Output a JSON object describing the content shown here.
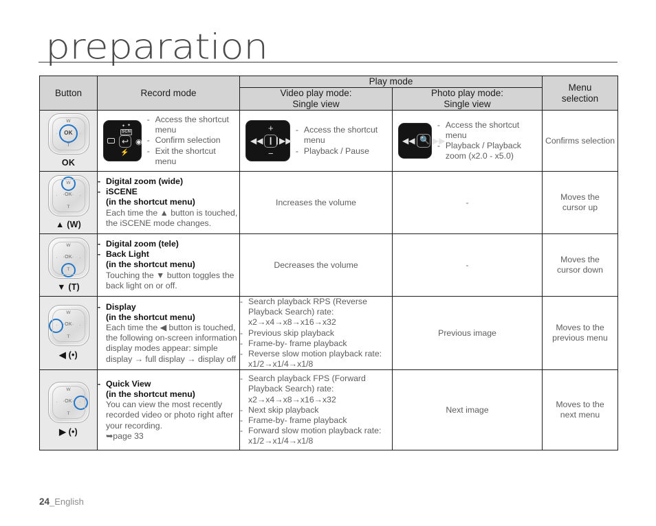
{
  "page": {
    "title": "preparation",
    "footer_page": "24",
    "footer_lang": "_English"
  },
  "accent_color": "#2176c9",
  "table": {
    "headers": {
      "button": "Button",
      "record_mode": "Record mode",
      "play_mode": "Play mode",
      "video_play_mode": "Video play mode:\nSingle view",
      "video_play_mode_l1": "Video play mode:",
      "video_play_mode_l2": "Single view",
      "photo_play_mode_l1": "Photo play mode:",
      "photo_play_mode_l2": "Single view",
      "menu_selection_l1": "Menu",
      "menu_selection_l2": "selection"
    },
    "rows": [
      {
        "button_label": "OK",
        "button_center_text": "OK",
        "pad_w": "W",
        "pad_t": "T",
        "record_items": [
          "Access the shortcut menu",
          "Confirm selection",
          "Exit the shortcut menu"
        ],
        "video_items": [
          "Access the shortcut menu",
          "Playback / Pause"
        ],
        "photo_items": [
          "Access the shortcut menu",
          "Playback / Playback zoom (x2.0 - x5.0)"
        ],
        "menu": "Confirms selection",
        "lcd_record_icons": [
          "scn-icon",
          "rectangle-icon",
          "return-arrow-icon",
          "play-circle-icon",
          "flash-icon"
        ],
        "lcd_video_icons": [
          "plus-icon",
          "prev-track-icon",
          "pause-icon",
          "next-track-icon",
          "minus-icon"
        ],
        "lcd_photo_icons": [
          "prev-track-icon",
          "zoom-in-icon",
          "next-track-icon"
        ]
      },
      {
        "button_label": "▲ (W)",
        "record_bold": [
          "Digital zoom (wide)",
          "iSCENE"
        ],
        "record_subbold": "(in the shortcut menu)",
        "record_desc": "Each time the ▲ button is touched, the iSCENE mode changes.",
        "video": "Increases the volume",
        "photo": "-",
        "menu_l1": "Moves the",
        "menu_l2": "cursor up"
      },
      {
        "button_label": "▼ (T)",
        "record_bold": [
          "Digital zoom (tele)",
          "Back Light"
        ],
        "record_subbold": "(in the shortcut menu)",
        "record_desc": "Touching the ▼ button toggles the back light on or off.",
        "video": "Decreases the volume",
        "photo": "-",
        "menu_l1": "Moves the",
        "menu_l2": "cursor down"
      },
      {
        "button_label": "◀ (•)",
        "record_bold": [
          "Display"
        ],
        "record_subbold": "(in the shortcut menu)",
        "record_desc": "Each time the ◀ button is touched, the following on-screen information display modes appear: simple display → full display → display off",
        "video_items": [
          "Search playback RPS (Reverse Playback Search) rate: x2→x4→x8→x16→x32",
          "Previous skip playback",
          "Frame-by- frame playback",
          "Reverse slow motion playback rate: x1/2→x1/4→x1/8"
        ],
        "photo": "Previous image",
        "menu_l1": "Moves to the",
        "menu_l2": "previous menu"
      },
      {
        "button_label": "▶ (•)",
        "record_bold": [
          "Quick View"
        ],
        "record_subbold": "(in the shortcut menu)",
        "record_desc": "You can view the most recently recorded video or photo right after your recording.",
        "record_ref": "➥page 33",
        "video_items": [
          "Search playback FPS (Forward Playback Search) rate: x2→x4→x8→x16→x32",
          "Next skip playback",
          "Frame-by- frame playback",
          "Forward slow motion playback rate: x1/2→x1/4→x1/8"
        ],
        "photo": "Next image",
        "menu_l1": "Moves to the",
        "menu_l2": "next menu"
      }
    ]
  }
}
